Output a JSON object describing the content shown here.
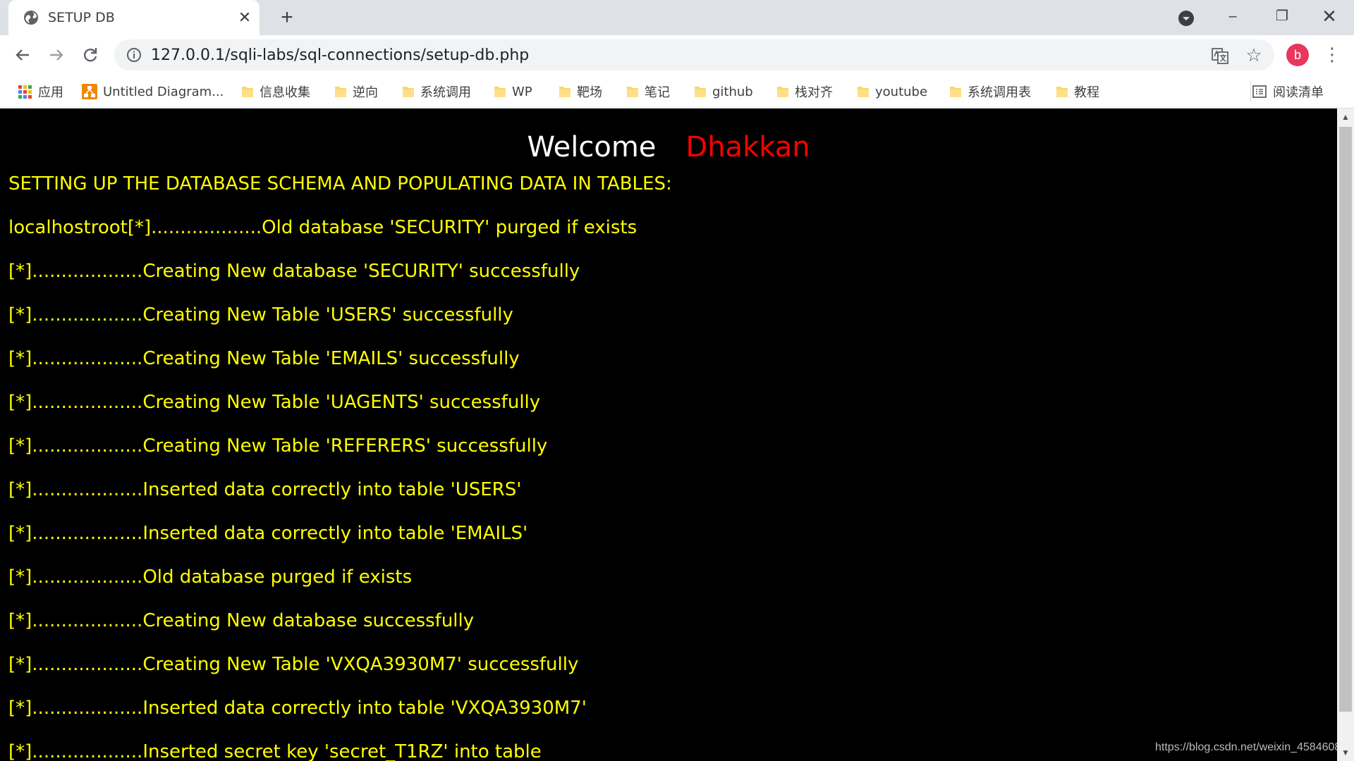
{
  "tab": {
    "title": "SETUP DB",
    "favicon": "globe-icon",
    "close": "✕",
    "new_tab": "+"
  },
  "window": {
    "minimize": "–",
    "restore": "❐",
    "close": "✕"
  },
  "toolbar": {
    "url": "127.0.0.1/sqli-labs/sql-connections/setup-db.php",
    "avatar_letter": "b",
    "avatar_color": "#e8365d",
    "menu": "⋮",
    "star": "☆"
  },
  "bookmarks": [
    {
      "label": "应用",
      "icon": "apps-icon"
    },
    {
      "label": "Untitled Diagram...",
      "icon": "diagram-icon"
    },
    {
      "label": "信息收集",
      "icon": "folder-icon"
    },
    {
      "label": "逆向",
      "icon": "folder-icon"
    },
    {
      "label": "系统调用",
      "icon": "folder-icon"
    },
    {
      "label": "WP",
      "icon": "folder-icon"
    },
    {
      "label": "靶场",
      "icon": "folder-icon"
    },
    {
      "label": "笔记",
      "icon": "folder-icon"
    },
    {
      "label": "github",
      "icon": "folder-icon"
    },
    {
      "label": "栈对齐",
      "icon": "folder-icon"
    },
    {
      "label": "youtube",
      "icon": "folder-icon"
    },
    {
      "label": "系统调用表",
      "icon": "folder-icon"
    },
    {
      "label": "教程",
      "icon": "folder-icon"
    }
  ],
  "reading_list": {
    "label": "阅读清单",
    "icon": "reading-list-icon"
  },
  "page": {
    "welcome_word": "Welcome",
    "welcome_name": "Dhakkan",
    "colors": {
      "text": "#ffff00",
      "name": "#ff0000",
      "welcome": "#ffffff",
      "background": "#000000"
    },
    "lines": [
      "SETTING UP THE DATABASE SCHEMA AND POPULATING DATA IN TABLES:",
      "localhostroot[*]...................Old database 'SECURITY' purged if exists",
      "[*]...................Creating New database 'SECURITY' successfully",
      "[*]...................Creating New Table 'USERS' successfully",
      "[*]...................Creating New Table 'EMAILS' successfully",
      "[*]...................Creating New Table 'UAGENTS' successfully",
      "[*]...................Creating New Table 'REFERERS' successfully",
      "[*]...................Inserted data correctly into table 'USERS'",
      "[*]...................Inserted data correctly into table 'EMAILS'",
      "[*]...................Old database purged if exists",
      "[*]...................Creating New database successfully",
      "[*]...................Creating New Table 'VXQA3930M7' successfully",
      "[*]...................Inserted data correctly into table 'VXQA3930M7'",
      "[*]...................Inserted secret key 'secret_T1RZ' into table"
    ],
    "watermark": "https://blog.csdn.net/weixin_4584608"
  }
}
